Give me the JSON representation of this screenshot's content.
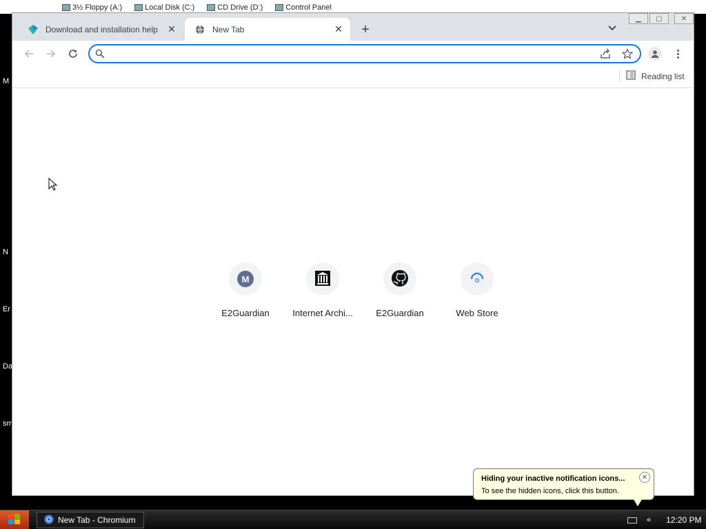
{
  "desktop": {
    "drives": [
      "3½ Floppy (A:)",
      "Local Disk (C:)",
      "CD Drive (D:)",
      "Control Panel"
    ],
    "left_labels": [
      "M",
      "N",
      "Er",
      "Da",
      "sm"
    ]
  },
  "browser": {
    "tabs": [
      {
        "title": "Download and installation help",
        "active": false,
        "icon": "colored-diamond-icon"
      },
      {
        "title": "New Tab",
        "active": true,
        "icon": "globe-icon"
      }
    ],
    "omnibox": {
      "value": "",
      "placeholder": ""
    },
    "bookmarks_bar": {
      "reading_list_label": "Reading list"
    },
    "shortcuts": [
      {
        "label": "E2Guardian",
        "icon": "m-letter-icon"
      },
      {
        "label": "Internet Archi...",
        "icon": "archive-building-icon"
      },
      {
        "label": "E2Guardian",
        "icon": "github-icon"
      },
      {
        "label": "Web Store",
        "icon": "webstore-icon"
      }
    ],
    "accent_color": "#1a73e8"
  },
  "balloon": {
    "title": "Hiding your inactive notification icons...",
    "body": "To see the hidden icons, click this button."
  },
  "taskbar": {
    "window_button": "New Tab - Chromium",
    "clock": "12:20 PM",
    "tray_chevron": "«"
  }
}
